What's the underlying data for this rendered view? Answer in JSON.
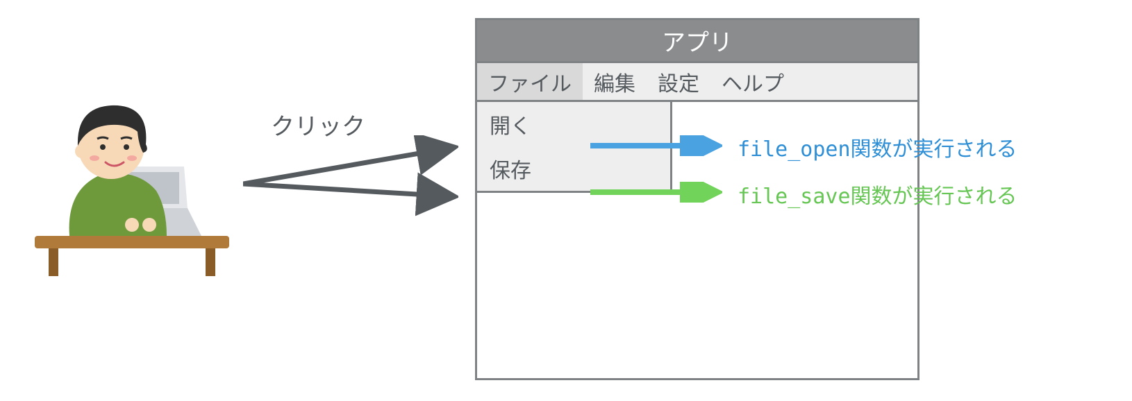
{
  "click_label": "クリック",
  "app": {
    "title": "アプリ",
    "menu": {
      "file": "ファイル",
      "edit": "編集",
      "settings": "設定",
      "help": "ヘルプ"
    },
    "dropdown": {
      "open": "開く",
      "save": "保存"
    }
  },
  "callouts": {
    "open_text": "file_open関数が実行される",
    "save_text": "file_save関数が実行される"
  },
  "colors": {
    "arrow_gray": "#555a5f",
    "arrow_blue": "#4aa3e0",
    "arrow_green": "#72d35a",
    "text_blue": "#2f8fd6",
    "text_green": "#66c653"
  }
}
